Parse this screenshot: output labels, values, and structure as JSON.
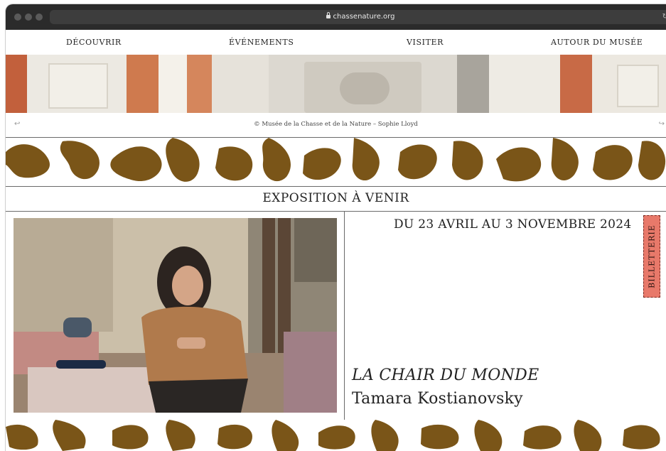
{
  "browser": {
    "url": "chassenature.org",
    "reload_icon": "↻"
  },
  "nav": {
    "items": [
      {
        "label": "DÉCOUVRIR"
      },
      {
        "label": "ÉVÉNEMENTS"
      },
      {
        "label": "VISITER"
      },
      {
        "label": "AUTOUR DU MUSÉE"
      }
    ]
  },
  "hero": {
    "caption": "© Musée de la Chasse et de la Nature – Sophie Lloyd",
    "prev_icon": "↩",
    "next_icon": "↪"
  },
  "exhibition": {
    "section_title": "EXPOSITION À VENIR",
    "dates": "DU 23 AVRIL AU 3 NOVEMBRE 2024",
    "title": "LA CHAIR DU MONDE",
    "artist": "Tamara Kostianovsky"
  },
  "ticketing": {
    "label": "BILLETTERIE"
  },
  "colors": {
    "pattern": "#7a5518",
    "ticket_bg": "#e8796a"
  }
}
